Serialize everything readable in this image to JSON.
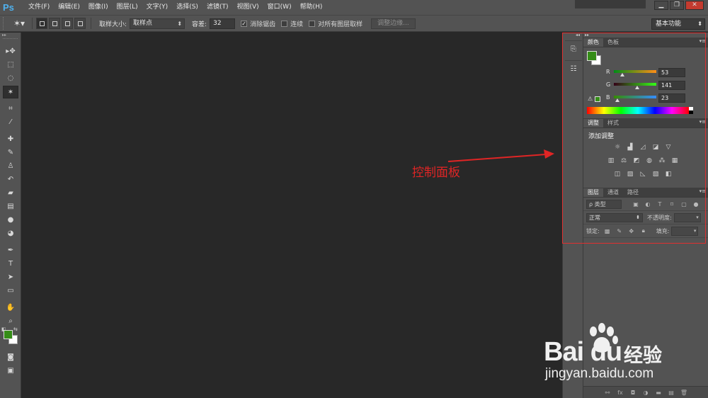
{
  "app": {
    "logo": "Ps",
    "menu": [
      "文件(F)",
      "编辑(E)",
      "图像(I)",
      "图层(L)",
      "文字(Y)",
      "选择(S)",
      "滤镜(T)",
      "视图(V)",
      "窗口(W)",
      "帮助(H)"
    ],
    "window_controls": [
      "▁",
      "❐",
      "✕"
    ]
  },
  "options": {
    "sample_size_label": "取样大小:",
    "sample_size_value": "取样点",
    "tolerance_label": "容差:",
    "tolerance_value": "32",
    "antialias_label": "消除锯齿",
    "antialias_checked": true,
    "contiguous_label": "连续",
    "contiguous_checked": false,
    "all_layers_label": "对所有图层取样",
    "all_layers_checked": false,
    "refine_edge_label": "调整边缘...",
    "workspace_value": "基本功能"
  },
  "tools": [
    "move-tool",
    "marquee-tool",
    "lasso-tool",
    "magic-wand-tool",
    "crop-tool",
    "eyedropper-tool",
    "healing-brush-tool",
    "brush-tool",
    "clone-stamp-tool",
    "history-brush-tool",
    "eraser-tool",
    "gradient-tool",
    "blur-tool",
    "dodge-tool",
    "pen-tool",
    "type-tool",
    "path-selection-tool",
    "shape-tool",
    "hand-tool",
    "zoom-tool"
  ],
  "colors": {
    "foreground": "#358d17",
    "background": "#ffffff",
    "annotation": "#e02525"
  },
  "annotation": {
    "text": "控制面板"
  },
  "color_panel": {
    "tabs": [
      "颜色",
      "色板"
    ],
    "r_label": "R",
    "g_label": "G",
    "b_label": "B",
    "r_value": "53",
    "g_value": "141",
    "b_value": "23"
  },
  "adjustments_panel": {
    "tabs": [
      "调整",
      "样式"
    ],
    "title": "添加调整"
  },
  "layers_panel": {
    "tabs": [
      "图层",
      "通道",
      "路径"
    ],
    "filter_value": "ρ 类型",
    "blend_mode": "正常",
    "opacity_label": "不透明度:",
    "lock_label": "锁定:",
    "fill_label": "填充:"
  },
  "watermark": {
    "brand": "Bai du",
    "brand_cn": "经验",
    "url": "jingyan.baidu.com"
  }
}
